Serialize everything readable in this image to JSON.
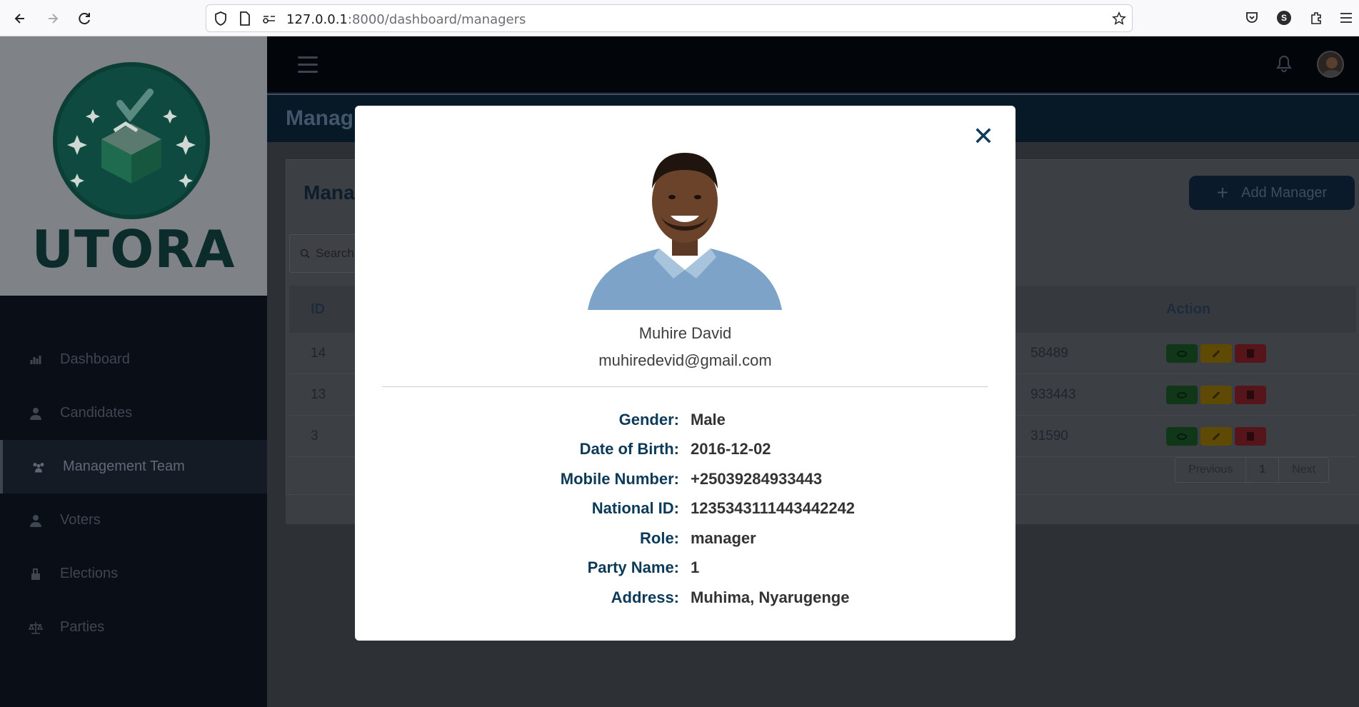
{
  "browser": {
    "url_host": "127.0.0.1",
    "url_path": ":8000/dashboard/managers",
    "profile_initial": "S"
  },
  "sidebar": {
    "logo_text": "UTORA",
    "items": [
      {
        "label": "Dashboard",
        "icon": "bar-chart-icon"
      },
      {
        "label": "Candidates",
        "icon": "user-icon"
      },
      {
        "label": "Management Team",
        "icon": "users-icon",
        "active": true
      },
      {
        "label": "Voters",
        "icon": "user-icon"
      },
      {
        "label": "Elections",
        "icon": "ballot-icon"
      },
      {
        "label": "Parties",
        "icon": "scale-icon"
      }
    ]
  },
  "header": {
    "page_title": "Manag"
  },
  "card": {
    "title": "Mana",
    "add_button_label": "Add Manager",
    "search_placeholder": "Search"
  },
  "table": {
    "headers": {
      "id": "ID",
      "action": "Action"
    },
    "rows": [
      {
        "id": "14",
        "phone_tail": "58489"
      },
      {
        "id": "13",
        "phone_tail": "933443"
      },
      {
        "id": "3",
        "phone_tail": "31590"
      }
    ]
  },
  "pagination": {
    "previous": "Previous",
    "current": "1",
    "next": "Next"
  },
  "modal": {
    "name": "Muhire David",
    "email": "muhiredevid@gmail.com",
    "details": [
      {
        "label": "Gender:",
        "value": "Male"
      },
      {
        "label": "Date of Birth:",
        "value": "2016-12-02"
      },
      {
        "label": "Mobile Number:",
        "value": "+25039284933443"
      },
      {
        "label": "National ID:",
        "value": "1235343111443442242"
      },
      {
        "label": "Role:",
        "value": "manager"
      },
      {
        "label": "Party Name:",
        "value": "1"
      },
      {
        "label": "Address:",
        "value": "Muhima, Nyarugenge"
      }
    ]
  },
  "colors": {
    "brand_navy": "#0d3a58",
    "view_button": "#1c8a3a",
    "edit_button": "#e0a800",
    "delete_button": "#c82333"
  }
}
